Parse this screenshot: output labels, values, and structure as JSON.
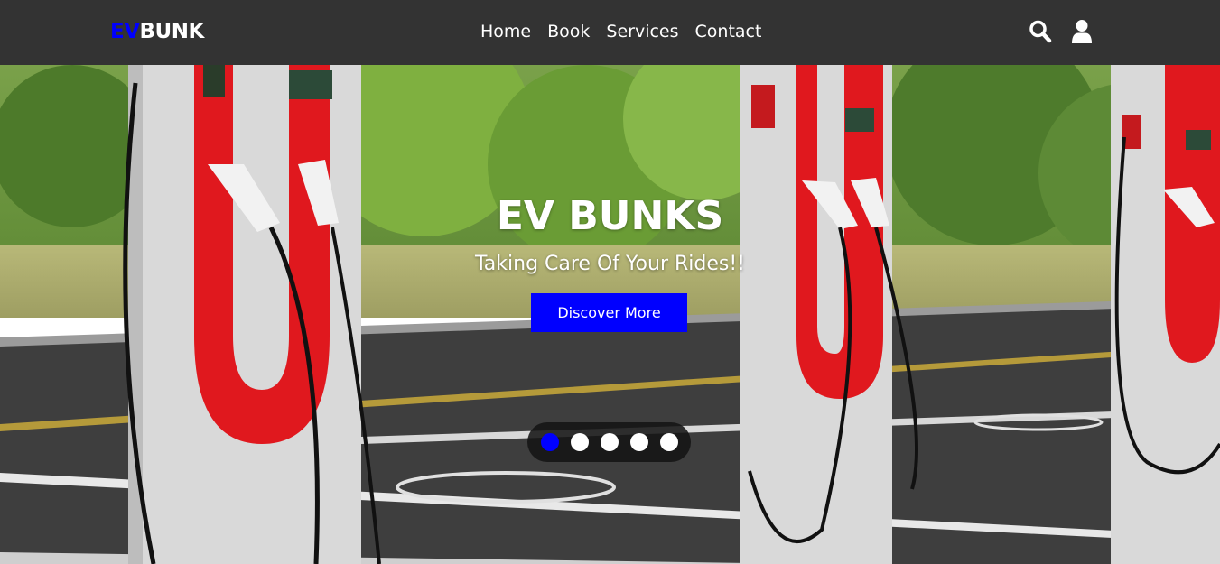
{
  "brand": {
    "accent": "EV",
    "rest": "BUNK",
    "accent_color": "#0000ff"
  },
  "nav": {
    "links": [
      "Home",
      "Book",
      "Services",
      "Contact"
    ]
  },
  "icons": {
    "search": "search-icon",
    "user": "user-icon"
  },
  "hero": {
    "title": "EV BUNKS",
    "subtitle": "Taking Care Of Your Rides!!",
    "cta": "Discover More",
    "cta_color": "#0000ff"
  },
  "carousel": {
    "slides": 5,
    "active_index": 0
  },
  "colors": {
    "navbar": "#333333",
    "accent": "#0000ff"
  }
}
